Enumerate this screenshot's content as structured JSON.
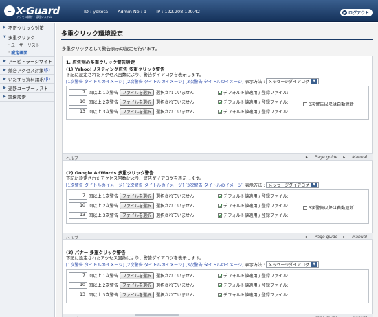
{
  "header": {
    "logo_text": "X-Guard",
    "logo_sub": "アクセス解析・管理システム",
    "id_label": "ID : yokota",
    "admin_label": "Admin No : 1",
    "ip_label": "IP : 122.208.129.42",
    "logout_label": "ログアウト"
  },
  "sidebar": {
    "item_fraud": "不正クリック対策",
    "item_multi": "多重クリック",
    "sub_users": "ユーザーリスト",
    "sub_settings": "設定画面",
    "item_affiliate": "アービトラージサイト",
    "item_competitor": "競合アクセス対策",
    "item_competitor_suffix": "(β)",
    "item_prank": "いたずら資料請求",
    "item_prank_suffix": "(β)",
    "item_withdraw": "退断ユーザーリスト",
    "item_env": "環境設定"
  },
  "main": {
    "title": "多重クリック環境設定",
    "desc": "多重クリックとして警告表示の設定を行います。",
    "section_title": "1. 広告別の多重クリック警告設定",
    "blocks": [
      {
        "title": "(1) Yahoo!リスティング広告 多重クリック警告"
      },
      {
        "title": "(2) Google AdWords 多重クリック警告"
      },
      {
        "title": "(3) バナー 多重クリック警告"
      }
    ],
    "block_desc": "下記に設定されたアクセス回数により、警告ダイアログを表示します。",
    "legend_1": "[1次警告 タイトルのイメージ]",
    "legend_2": "[2次警告 タイトルのイメージ]",
    "legend_3": "[3次警告 タイトルのイメージ]",
    "display_method": "表示方法 :",
    "display_select": "メッセージダイアログ",
    "warn_rows": [
      {
        "count": "7",
        "label": "回以上 1次警告"
      },
      {
        "count": "10",
        "label": "回以上 2次警告"
      },
      {
        "count": "13",
        "label": "回以上 3次警告"
      }
    ],
    "file_button": "ファイルを選択",
    "no_file": "選択されていません",
    "default_apply": "デフォルト値適用 / 登録ファイル:",
    "auto_block": "3次警告以降は自動遮断",
    "help": "ヘルプ",
    "page_guide": "Page guide",
    "manual": "Manual"
  },
  "colors": {
    "header": "#1a3a66",
    "link": "#2545a8",
    "check": "#1a8a2a"
  }
}
